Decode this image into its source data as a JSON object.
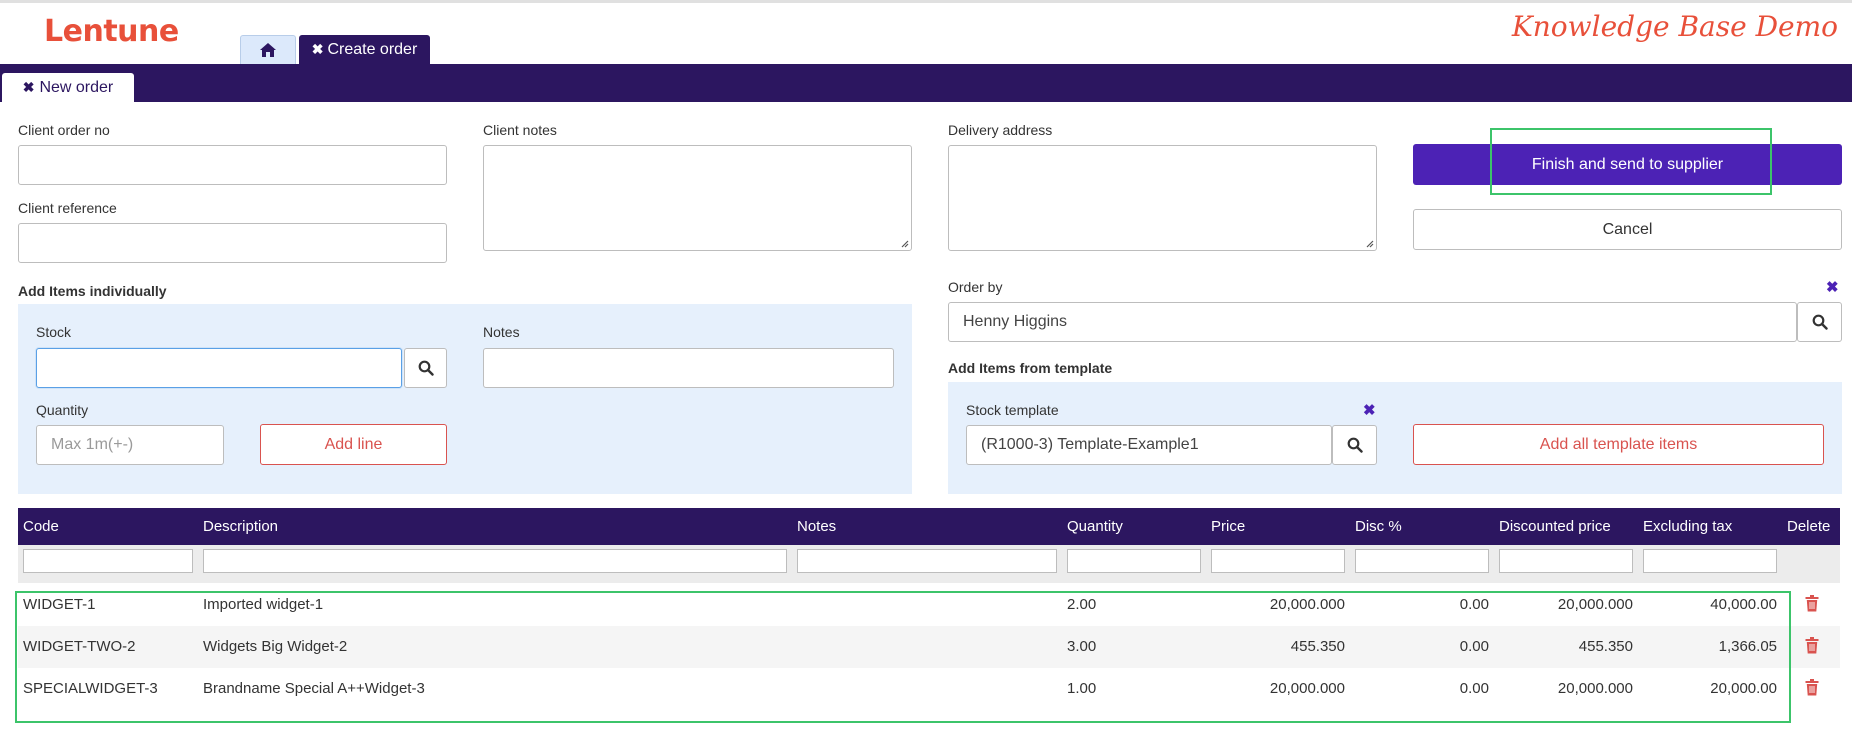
{
  "brand": {
    "logo_text": "Lentune",
    "demo_text": "Knowledge Base Demo"
  },
  "tabs": {
    "create_order_label": "Create order",
    "new_order_label": "New order"
  },
  "form": {
    "client_order_no_label": "Client order no",
    "client_order_no_value": "",
    "client_reference_label": "Client reference",
    "client_reference_value": "",
    "client_notes_label": "Client notes",
    "delivery_address_label": "Delivery address",
    "order_by_label": "Order by",
    "order_by_value": "Henny Higgins"
  },
  "actions": {
    "finish_label": "Finish and send to supplier",
    "cancel_label": "Cancel"
  },
  "add_items": {
    "title": "Add Items individually",
    "stock_label": "Stock",
    "notes_label": "Notes",
    "quantity_label": "Quantity",
    "quantity_placeholder": "Max 1m(+-)",
    "add_line_label": "Add line"
  },
  "template": {
    "title": "Add Items from template",
    "stock_template_label": "Stock template",
    "stock_template_value": "(R1000-3) Template-Example1",
    "add_all_label": "Add all template items"
  },
  "table": {
    "columns": [
      "Code",
      "Description",
      "Notes",
      "Quantity",
      "Price",
      "Disc %",
      "Discounted price",
      "Excluding tax",
      "Delete"
    ],
    "rows": [
      {
        "code": "WIDGET-1",
        "description": "Imported widget-1",
        "notes": "",
        "quantity": "2.00",
        "price": "20,000.000",
        "disc": "0.00",
        "discounted_price": "20,000.000",
        "excluding_tax": "40,000.00"
      },
      {
        "code": "WIDGET-TWO-2",
        "description": "Widgets Big Widget-2",
        "notes": "",
        "quantity": "3.00",
        "price": "455.350",
        "disc": "0.00",
        "discounted_price": "455.350",
        "excluding_tax": "1,366.05"
      },
      {
        "code": "SPECIALWIDGET-3",
        "description": "Brandname Special A++Widget-3",
        "notes": "",
        "quantity": "1.00",
        "price": "20,000.000",
        "disc": "0.00",
        "discounted_price": "20,000.000",
        "excluding_tax": "20,000.00"
      }
    ]
  },
  "colors": {
    "brand_red": "#e8503a",
    "nav_purple": "#2c1660",
    "primary_purple": "#4c22b5",
    "panel_blue": "#e6f0fc",
    "highlight_green": "#3cc46a",
    "delete_red": "#d9534f"
  },
  "icons": [
    "home-icon",
    "close-icon",
    "search-icon",
    "trash-icon"
  ]
}
